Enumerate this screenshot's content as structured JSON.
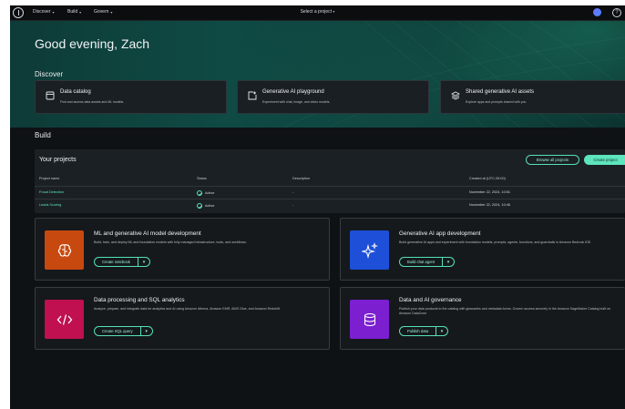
{
  "nav": {
    "items": [
      {
        "label": "Discover"
      },
      {
        "label": "Build"
      },
      {
        "label": "Govern"
      }
    ],
    "project_selector": "Select a project"
  },
  "hero": {
    "greeting": "Good evening, Zach",
    "discover_label": "Discover"
  },
  "discover_cards": [
    {
      "title": "Data catalog",
      "description": "Find and access data assets and ML models.",
      "icon": "catalog-icon"
    },
    {
      "title": "Generative AI playground",
      "description": "Experiment with chat, image, and video models.",
      "icon": "playground-icon"
    },
    {
      "title": "Shared generative AI assets",
      "description": "Explore apps and prompts shared with you.",
      "icon": "shared-assets-icon"
    }
  ],
  "build": {
    "label": "Build",
    "projects": {
      "title": "Your projects",
      "browse_label": "Browse all projects",
      "create_label": "Create project",
      "columns": [
        "Project name",
        "Status",
        "Description",
        "Created at (UTC-05:00)"
      ],
      "rows": [
        {
          "name": "Fraud Detection",
          "status": "Active",
          "description": "-",
          "created": "November 22, 2024, 10:51"
        },
        {
          "name": "Leads Scoring",
          "status": "Active",
          "description": "-",
          "created": "November 22, 2024, 10:46"
        }
      ]
    }
  },
  "features": [
    {
      "title": "ML and generative AI model development",
      "description": "Build, train, and deploy ML and foundation models with fully managed infrastructure, tools, and workflows.",
      "action": "Create notebook",
      "icon": "brain-icon",
      "color": "#c8490f"
    },
    {
      "title": "Generative AI app development",
      "description": "Build generative AI apps and experiment with foundation models, prompts, agents, functions, and guardrails in Amazon Bedrock IDE.",
      "action": "Build chat agent",
      "icon": "sparkle-icon",
      "color": "#1d4fd8"
    },
    {
      "title": "Data processing and SQL analytics",
      "description": "Analyze, prepare, and integrate data for analytics and AI using Amazon Athena, Amazon EMR, AWS Glue, and Amazon Redshift.",
      "action": "Create SQL query",
      "icon": "code-icon",
      "color": "#c0104f"
    },
    {
      "title": "Data and AI governance",
      "description": "Publish your data products to the catalog with glossaries and metadata forms. Govern access securely in the Amazon SageMaker Catalog built on Amazon DataZone.",
      "action": "Publish data",
      "icon": "database-icon",
      "color": "#7b1fd0"
    }
  ]
}
